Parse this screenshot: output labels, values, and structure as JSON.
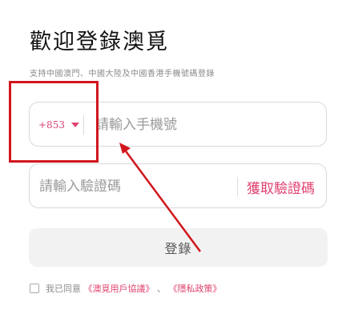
{
  "header": {
    "title": "歡迎登錄澳覓",
    "subtitle": "支持中國澳門、中國大陸及中國香港手機號碼登錄"
  },
  "phone": {
    "country_code": "+853",
    "placeholder": "請輸入手機號"
  },
  "verification": {
    "placeholder": "請輸入驗證碼",
    "get_code_label": "獲取驗證碼"
  },
  "login": {
    "button_label": "登錄"
  },
  "agreement": {
    "prefix": "我已同意",
    "user_agreement": "《澳覓用戶協議》",
    "separator": "、",
    "privacy_policy": "《隱私政策》"
  },
  "colors": {
    "accent": "#e0426f",
    "annotation": "#d0161c"
  },
  "icons": {
    "country_dropdown": "caret-down-icon"
  }
}
